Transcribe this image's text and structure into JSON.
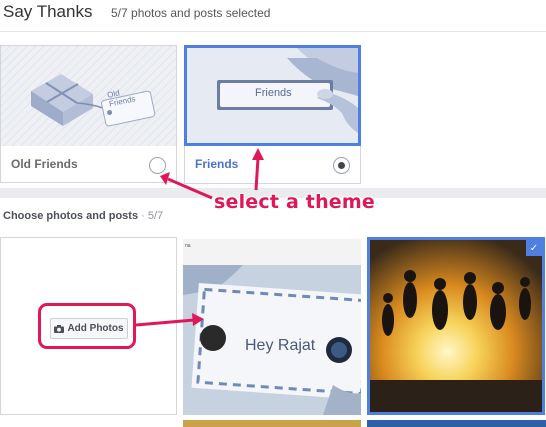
{
  "header": {
    "title": "Say Thanks",
    "subtitle": "5/7 photos and posts selected"
  },
  "themes": [
    {
      "label": "Old Friends",
      "tag_text": "Old\nFriends",
      "selected": false
    },
    {
      "label": "Friends",
      "tag_text": "Friends",
      "selected": true
    }
  ],
  "section": {
    "title": "Choose photos and posts",
    "count": " · 5/7"
  },
  "photos": {
    "add_button": "Add Photos",
    "postcard_text": "Hey Rajat",
    "postcard_caption": "na"
  },
  "annotations": {
    "select_theme": "select a theme"
  },
  "colors": {
    "accent": "#4f7fe0",
    "annotation": "#e0185a",
    "selected_label": "#4b73c9"
  }
}
